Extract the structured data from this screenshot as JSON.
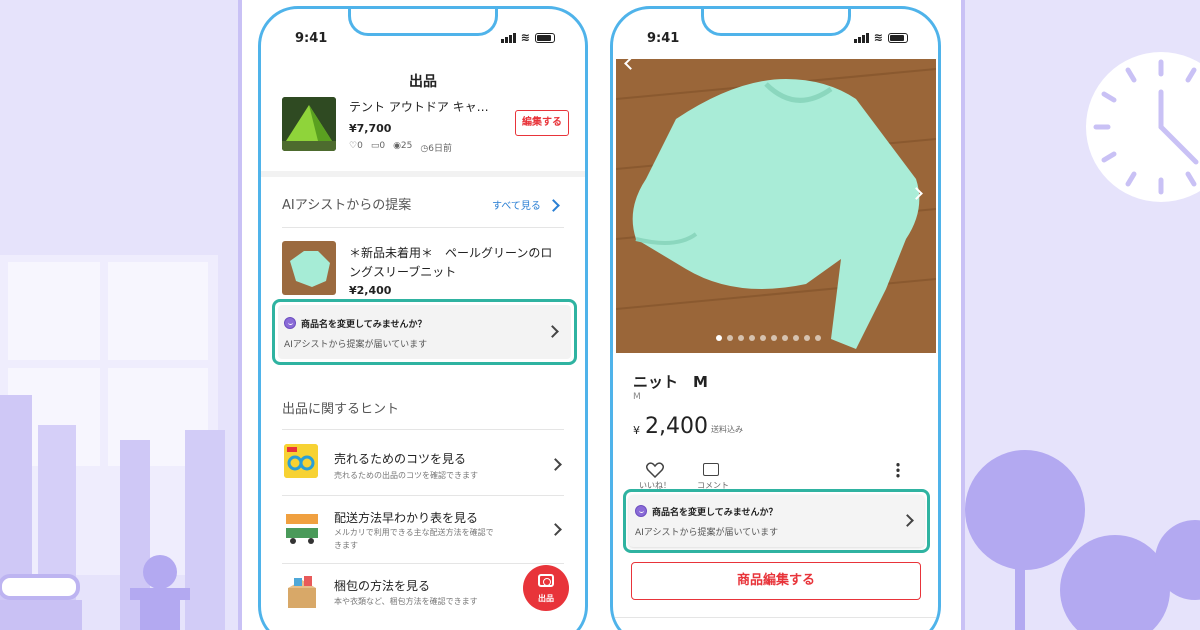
{
  "colors": {
    "accent": "#e8343a",
    "ai_highlight": "#2fb3a1",
    "phone_frame": "#4fb3ea",
    "background": "#e4e1fb",
    "link": "#2a7fd4"
  },
  "left_phone": {
    "status_time": "9:41",
    "title": "出品",
    "listing": {
      "name": "テント アウトドア キャ…",
      "price": "¥7,700",
      "likes": "0",
      "comments": "0",
      "views": "25",
      "time_ago": "6日前",
      "edit_button": "編集する",
      "thumb_icon": "tent-image"
    },
    "ai_section": {
      "heading": "AIアシストからの提案",
      "see_all": "すべて見る"
    },
    "ai_item": {
      "name_line1": "＊新品未着用＊　ペールグリーンのロ",
      "name_line2": "ングスリーブニット",
      "price": "¥2,400",
      "thumb_icon": "sweater-image"
    },
    "ai_suggestion": {
      "title": "商品名を変更してみませんか？",
      "subtitle": "AIアシストから提案が届いています",
      "icon": "ai-assist-icon"
    },
    "hints": {
      "heading": "出品に関するヒント",
      "items": [
        {
          "title": "売れるためのコツを見る",
          "desc": "売れるための出品のコツを確認できます",
          "icon": "glasses-icon"
        },
        {
          "title": "配送方法早わかり表を見る",
          "desc_line1": "メルカリで利用できる主な配送方法を確認で",
          "desc_line2": "きます",
          "icon": "shipping-icon"
        },
        {
          "title": "梱包の方法を見る",
          "desc": "本や衣類など、梱包方法を確認できます",
          "icon": "box-icon"
        }
      ]
    },
    "fab_label": "出品"
  },
  "right_phone": {
    "status_time": "9:41",
    "carousel": {
      "current_index": 1,
      "count": 10,
      "image": "sweater-photo"
    },
    "product": {
      "name": "ニット　M",
      "size": "M",
      "currency": "¥",
      "price": "2,400",
      "shipping": "送料込み",
      "like_label": "いいね！",
      "comment_label": "コメント"
    },
    "ai_suggestion": {
      "title": "商品名を変更してみませんか？",
      "subtitle": "AIアシストから提案が届いています",
      "icon": "ai-assist-icon"
    },
    "edit_button": "商品編集する"
  }
}
